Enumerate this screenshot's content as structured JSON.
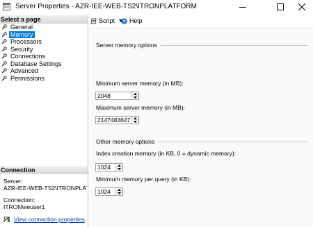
{
  "window": {
    "title": "Server Properties - AZR-IEE-WEB-TS2\\ITRONPLATFORM",
    "controls": [
      "minimize-icon",
      "maximize-icon",
      "close-icon"
    ]
  },
  "left_pane": {
    "select_page_header": "Select a page",
    "pages": [
      {
        "label": "General",
        "icon": "wrench-icon"
      },
      {
        "label": "Memory",
        "icon": "wrench-icon",
        "selected": true
      },
      {
        "label": "Processors",
        "icon": "wrench-icon"
      },
      {
        "label": "Security",
        "icon": "wrench-icon"
      },
      {
        "label": "Connections",
        "icon": "wrench-icon"
      },
      {
        "label": "Database Settings",
        "icon": "wrench-icon"
      },
      {
        "label": "Advanced",
        "icon": "wrench-icon"
      },
      {
        "label": "Permissions",
        "icon": "wrench-icon"
      }
    ],
    "connection_header": "Connection",
    "server_label": "Server:",
    "server_value": "AZR-IEE-WEB-TS2\\ITRONPLATF",
    "connection_label": "Connection:",
    "connection_value": "ITRON\\eeuser1",
    "view_link": "View connection properties"
  },
  "toolbar": {
    "script_label": "Script",
    "help_label": "Help"
  },
  "main": {
    "server_memory_options": "Server memory options",
    "min_label": "Minimum server memory (in MB):",
    "min_value": "2048",
    "max_label": "Maximum server memory (in MB):",
    "max_value": "2147483647",
    "other_memory_options": "Other memory options",
    "index_label": "Index creation memory (in KB, 0 = dynamic memory):",
    "index_value": "1024",
    "min_query_label": "Minimum memory per query (in KB):",
    "min_query_value": "1024"
  },
  "colors": {
    "selection": "#0078d7",
    "link": "#0645ad"
  }
}
